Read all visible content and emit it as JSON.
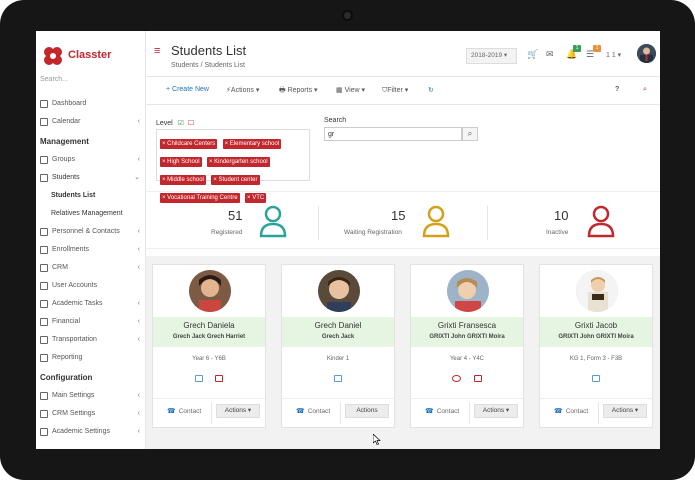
{
  "app": {
    "name": "Classter"
  },
  "sidebar": {
    "search_placeholder": "Search...",
    "items_top": [
      {
        "label": "Dashboard",
        "icon": "monitor-icon",
        "chev": ""
      },
      {
        "label": "Calendar",
        "icon": "calendar-icon",
        "chev": "‹"
      }
    ],
    "section_management": "Management",
    "items_mgmt": [
      {
        "label": "Groups",
        "icon": "groups-icon",
        "chev": "‹"
      },
      {
        "label": "Students",
        "icon": "students-icon",
        "chev": "⌄"
      }
    ],
    "students_sub": [
      "Students List",
      "Relatives Management"
    ],
    "items_mgmt2": [
      {
        "label": "Personnel & Contacts",
        "icon": "personnel-icon",
        "chev": "‹"
      },
      {
        "label": "Enrollments",
        "icon": "enrollments-icon",
        "chev": "‹"
      },
      {
        "label": "CRM",
        "icon": "crm-icon",
        "chev": "‹"
      },
      {
        "label": "User Accounts",
        "icon": "key-icon",
        "chev": ""
      },
      {
        "label": "Academic Tasks",
        "icon": "tasks-icon",
        "chev": "‹"
      },
      {
        "label": "Financial",
        "icon": "financial-icon",
        "chev": "‹"
      },
      {
        "label": "Transportation",
        "icon": "bus-icon",
        "chev": "‹"
      },
      {
        "label": "Reporting",
        "icon": "reporting-icon",
        "chev": ""
      }
    ],
    "section_configuration": "Configuration",
    "items_config": [
      {
        "label": "Main Settings",
        "icon": "settings-icon",
        "chev": "‹"
      },
      {
        "label": "CRM Settings",
        "icon": "crm-settings-icon",
        "chev": "‹"
      },
      {
        "label": "Academic Settings",
        "icon": "academic-settings-icon",
        "chev": "‹"
      }
    ]
  },
  "header": {
    "title": "Students List",
    "breadcrumb": "Students /  Students List",
    "year": "2018-2019 ▾",
    "badge_green": "1",
    "badge_orange": "1",
    "user_count": "1 1 ▾"
  },
  "toolbar": {
    "create": "+ Create New",
    "actions": "Actions ▾",
    "reports": "Reports ▾",
    "view": "View ▾",
    "filter": "Filter ▾",
    "help": "?"
  },
  "filters": {
    "level_label": "Level",
    "tags": [
      "Childcare Centers",
      "Elementary school",
      "High School",
      "Kindergarten school",
      "Middle school",
      "Student center",
      "Vocational Training Centre",
      "VTC"
    ],
    "search_label": "Search",
    "search_value": "gr"
  },
  "stats": [
    {
      "value": "51",
      "label": "Registered",
      "color": "#2aa39a"
    },
    {
      "value": "15",
      "label": "Waiting Registration",
      "color": "#d4a017"
    },
    {
      "value": "10",
      "label": "Inactive",
      "color": "#c1272d"
    }
  ],
  "cards": [
    {
      "name": "Grech Daniela",
      "parents": "Grech Jack Grech Harriet",
      "grade": "Year 6  -  Y6B",
      "contact": "Contact",
      "actions": "Actions ▾",
      "photo_bg": "#8a5a3b"
    },
    {
      "name": "Grech Daniel",
      "parents": "Grech Jack",
      "grade": "Kinder 1",
      "contact": "Contact",
      "actions": "Actions",
      "photo_bg": "#6b4a2f"
    },
    {
      "name": "Grixti Fransesca",
      "parents": "GRIXTI John GRIXTI Moira",
      "grade": "Year 4  -  Y4C",
      "contact": "Contact",
      "actions": "Actions ▾",
      "photo_bg": "#c9a07a"
    },
    {
      "name": "Grixti Jacob",
      "parents": "GRIXTI John GRIXTI Moira",
      "grade": "KG 1, Form 3  -  F3B",
      "contact": "Contact",
      "actions": "Actions ▾",
      "photo_bg": "#d9c7a8"
    }
  ]
}
